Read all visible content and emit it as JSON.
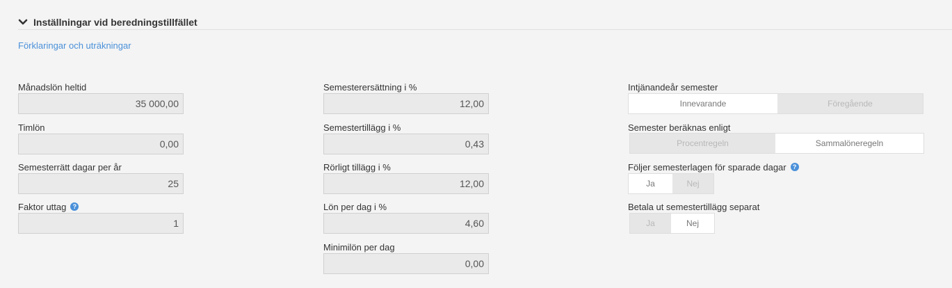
{
  "section": {
    "title": "Inställningar vid beredningstillfället",
    "link": "Förklaringar och uträkningar"
  },
  "left": {
    "monthly_salary": {
      "label": "Månadslön heltid",
      "value": "35 000,00"
    },
    "hourly_wage": {
      "label": "Timlön",
      "value": "0,00"
    },
    "vacation_days": {
      "label": "Semesterrätt dagar per år",
      "value": "25"
    },
    "withdrawal_factor": {
      "label": "Faktor uttag",
      "value": "1"
    }
  },
  "middle": {
    "vacation_comp": {
      "label": "Semesterersättning i %",
      "value": "12,00"
    },
    "vacation_supplement": {
      "label": "Semestertillägg i %",
      "value": "0,43"
    },
    "variable_supplement": {
      "label": "Rörligt tillägg i %",
      "value": "12,00"
    },
    "daily_pay": {
      "label": "Lön per dag i %",
      "value": "4,60"
    },
    "min_daily_pay": {
      "label": "Minimilön per dag",
      "value": "0,00"
    }
  },
  "right": {
    "earning_year": {
      "label": "Intjänandeår semester",
      "options": [
        "Innevarande",
        "Föregående"
      ],
      "selected": "Innevarande"
    },
    "calc_method": {
      "label": "Semester beräknas enligt",
      "options": [
        "Procentregeln",
        "Sammalöneregeln"
      ],
      "selected": "Sammalöneregeln"
    },
    "follows_law": {
      "label": "Följer semesterlagen för sparade dagar",
      "options": [
        "Ja",
        "Nej"
      ],
      "selected": "Ja"
    },
    "pay_supplement_separately": {
      "label": "Betala ut semestertillägg separat",
      "options": [
        "Ja",
        "Nej"
      ],
      "selected": "Nej"
    }
  },
  "icons": {
    "collapse": "chevron-down-icon",
    "help": "help-circle-icon"
  },
  "colors": {
    "link": "#4a90d9",
    "background": "#f4f4f4",
    "input_background": "#eaeaea"
  }
}
